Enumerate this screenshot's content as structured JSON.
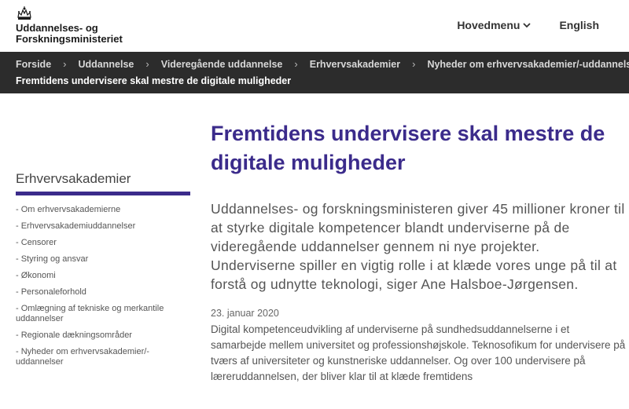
{
  "header": {
    "logo_line1": "Uddannelses- og",
    "logo_line2": "Forskningsministeriet",
    "menu_label": "Hovedmenu",
    "language_label": "English"
  },
  "breadcrumb": {
    "items": [
      "Forside",
      "Uddannelse",
      "Videregående uddannelse",
      "Erhvervsakademier",
      "Nyheder om erhvervsakademier/-uddannelser"
    ],
    "current": "Fremtidens undervisere skal mestre de digitale muligheder"
  },
  "sidebar": {
    "title": "Erhvervsakademier",
    "items": [
      "- Om erhvervsakademierne",
      "- Erhvervsakademiuddannelser",
      "- Censorer",
      "- Styring og ansvar",
      "- Økonomi",
      "- Personaleforhold",
      "- Omlægning af tekniske og merkantile uddannelser",
      "- Regionale dækningsområder",
      "- Nyheder om erhvervsakademier/-uddannelser"
    ]
  },
  "article": {
    "title": "Fremtidens undervisere skal mestre de digitale muligheder",
    "lead": "Uddannelses- og forskningsministeren giver 45 millioner kroner til at styrke digitale kompetencer blandt underviserne på de videregående uddannelser gennem ni nye projekter. Underviserne spiller en vigtig rolle i at klæde vores unge på til at forstå og udnytte teknologi, siger Ane Halsboe-Jørgensen.",
    "date": "23. januar 2020",
    "body": "Digital kompetenceudvikling af underviserne på sundhedsuddannelserne i et samarbejde mellem universitet og professionshøjskole. Teknosofikum for undervisere på tværs af universiteter og kunstneriske uddannelser. Og over 100 undervisere på læreruddannelsen, der bliver klar til at klæde fremtidens"
  },
  "colors": {
    "accent": "#3b2b8b",
    "breadcrumb_bg": "#2c2c2c"
  },
  "icons": {
    "logo": "crown-icon",
    "menu": "chevron-down-icon"
  }
}
